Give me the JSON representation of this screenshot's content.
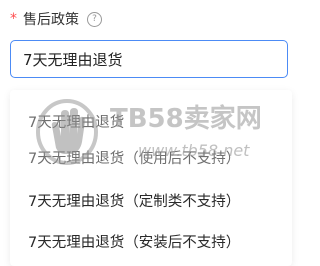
{
  "field": {
    "required_mark": "*",
    "label": "售后政策",
    "help_icon_glyph": "?",
    "selected_value": "7天无理由退货"
  },
  "dropdown": {
    "options": [
      {
        "label": "7天无理由退货"
      },
      {
        "label": "7天无理由退货（使用后不支持）"
      },
      {
        "label": "7天无理由退货（定制类不支持）"
      },
      {
        "label": "7天无理由退货（安装后不支持）"
      }
    ]
  },
  "watermark": {
    "brand": "TB58卖家网",
    "url": "www.tb58.net"
  },
  "colors": {
    "required": "#ff4d4f",
    "focus_border": "#4c8bf5",
    "text": "#333333"
  }
}
